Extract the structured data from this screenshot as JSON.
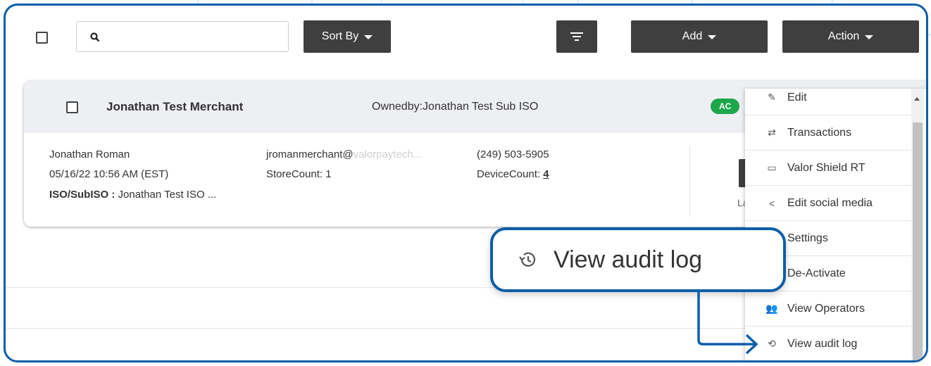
{
  "toolbar": {
    "search_placeholder": "",
    "sort_label": "Sort By",
    "add_label": "Add",
    "action_label": "Action"
  },
  "merchant": {
    "name": "Jonathan Test Merchant",
    "owned_by": "Ownedby:Jonathan Test Sub ISO",
    "status": "AC",
    "contact_name": "Jonathan Roman",
    "created": "05/16/22 10:56 AM (EST)",
    "iso_label": "ISO/SubISO :",
    "iso_value": "Jonathan Test ISO ...",
    "email": "jromanmerchant@",
    "email_rest": "valorpaytech...",
    "store_count": "StoreCount: 1",
    "phone": "(249) 503-5905",
    "device_count_label": "DeviceCount:",
    "device_count": "4",
    "last_label": "La"
  },
  "action_menu": {
    "items": [
      {
        "label": "Edit",
        "icon": "pencil-icon"
      },
      {
        "label": "Transactions",
        "icon": "transfer-icon"
      },
      {
        "label": "Valor Shield RT",
        "icon": "shield-rt-icon"
      },
      {
        "label": "Edit social media",
        "icon": "share-icon"
      },
      {
        "label": "Settings",
        "icon": "gear-icon"
      },
      {
        "label": "De-Activate",
        "icon": "power-icon"
      },
      {
        "label": "View Operators",
        "icon": "people-icon"
      },
      {
        "label": "View audit log",
        "icon": "history-icon"
      }
    ]
  },
  "callout": {
    "label": "View audit log",
    "icon": "history-icon"
  },
  "colors": {
    "frame": "#0d5ea8",
    "button": "#3f3f3f",
    "status_active": "#1ea64b"
  }
}
